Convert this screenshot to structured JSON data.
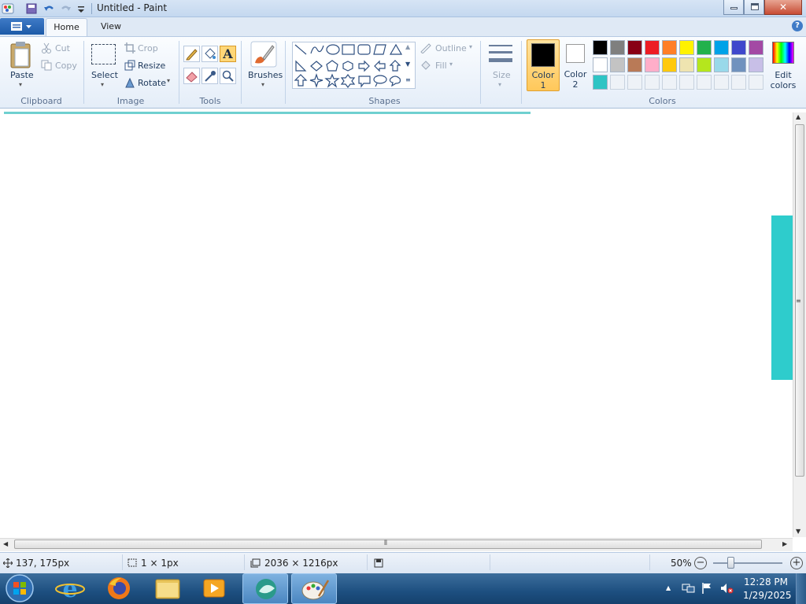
{
  "window": {
    "title": "Untitled - Paint",
    "buttons": {
      "minimize": "–",
      "maximize": "□",
      "close": "✕"
    }
  },
  "tabs": [
    {
      "label": "Home"
    },
    {
      "label": "View"
    }
  ],
  "help_glyph": "?",
  "ribbon": {
    "clipboard": {
      "label": "Clipboard",
      "paste": "Paste",
      "cut": "Cut",
      "copy": "Copy"
    },
    "image": {
      "label": "Image",
      "select": "Select",
      "crop": "Crop",
      "resize": "Resize",
      "rotate": "Rotate"
    },
    "tools": {
      "label": "Tools"
    },
    "brushes": {
      "label": "Brushes"
    },
    "shapes": {
      "label": "Shapes",
      "outline": "Outline",
      "fill": "Fill"
    },
    "size": {
      "label": "Size"
    },
    "colors": {
      "label": "Colors",
      "color1_line1": "Color",
      "color1_line2": "1",
      "color2_line1": "Color",
      "color2_line2": "2",
      "edit_line1": "Edit",
      "edit_line2": "colors",
      "color1_value": "#000000",
      "color2_value": "#ffffff",
      "palette": [
        "#000000",
        "#7f7f7f",
        "#880015",
        "#ed1c24",
        "#ff7f27",
        "#fff200",
        "#22b14c",
        "#00a2e8",
        "#3f48cc",
        "#a349a4",
        "#ffffff",
        "#c3c3c3",
        "#b97a57",
        "#ffaec9",
        "#ffc90e",
        "#efe4b0",
        "#b5e61d",
        "#99d9ea",
        "#7092be",
        "#c8bfe7",
        "#2ec4c4",
        "",
        "",
        "",
        "",
        "",
        "",
        "",
        "",
        ""
      ]
    }
  },
  "canvas": {
    "accent_color": "#2ecccc"
  },
  "status": {
    "cursor_pos": "137, 175px",
    "selection_size": "1 × 1px",
    "image_size": "2036 × 1216px",
    "zoom": "50%"
  },
  "taskbar": {
    "items": [
      "start-orb",
      "internet-explorer",
      "firefox",
      "file-explorer",
      "media-player",
      "active-app",
      "paint"
    ],
    "clock_time": "12:28 PM",
    "clock_date": "1/29/2025"
  }
}
